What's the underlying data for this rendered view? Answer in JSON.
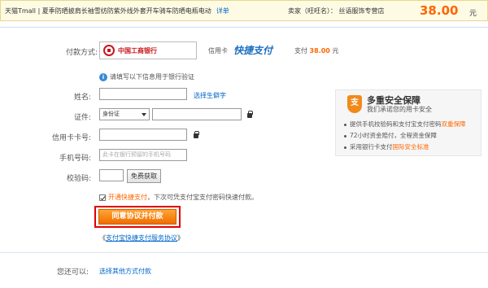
{
  "order": {
    "title": "天猫Tmall | 夏季防晒披肩长袖雪纺防紫外线外套开车骑车防晒电瓶电动",
    "detail_link": "详单",
    "seller": "卖家（旺旺名）： 丝语服饰专营店",
    "price": "38.00",
    "price_unit": "元"
  },
  "payment": {
    "method_label": "付款方式:",
    "bank_name": "中国工商银行",
    "card_type": "信用卡",
    "quick_pay_logo": "快捷支付",
    "amount_label": "支付",
    "amount": "38.00",
    "amount_unit": "元"
  },
  "notice": {
    "icon": "i",
    "text": "请填写以下信息用于银行验证"
  },
  "form": {
    "name_label": "姓名:",
    "rare_char_link": "选择生僻字",
    "id_label": "证件:",
    "id_type": "身份证",
    "card_label": "信用卡卡号:",
    "phone_label": "手机号码:",
    "phone_placeholder": "此卡在银行预留的手机号码",
    "code_label": "校验码:",
    "get_code_button": "免费获取"
  },
  "agreement": {
    "prefix": "开通快捷支付",
    "suffix": "，下次可凭支付宝支付密码快速付款。",
    "confirm_button": "同意协议并付款",
    "service_prefix": "《",
    "service_link": "支付宝快捷支付服务协议",
    "service_suffix": "》"
  },
  "other": {
    "label": "您还可以:",
    "link": "选择其他方式付款"
  },
  "security": {
    "icon": "支",
    "title": "多重安全保障",
    "subtitle": "我们承诺您的用卡安全",
    "item1_pre": "提供手机校验码和支付宝支付密码",
    "item1_hl": "双重保障",
    "item2": "72小时资金赔付，全程资金保障",
    "item3_pre": "采用银行卡支付",
    "item3_hl": "国际安全标准"
  },
  "colors": {
    "accent_orange": "#ff6600",
    "link_blue": "#0066cc",
    "highlight_red": "#e00000"
  }
}
